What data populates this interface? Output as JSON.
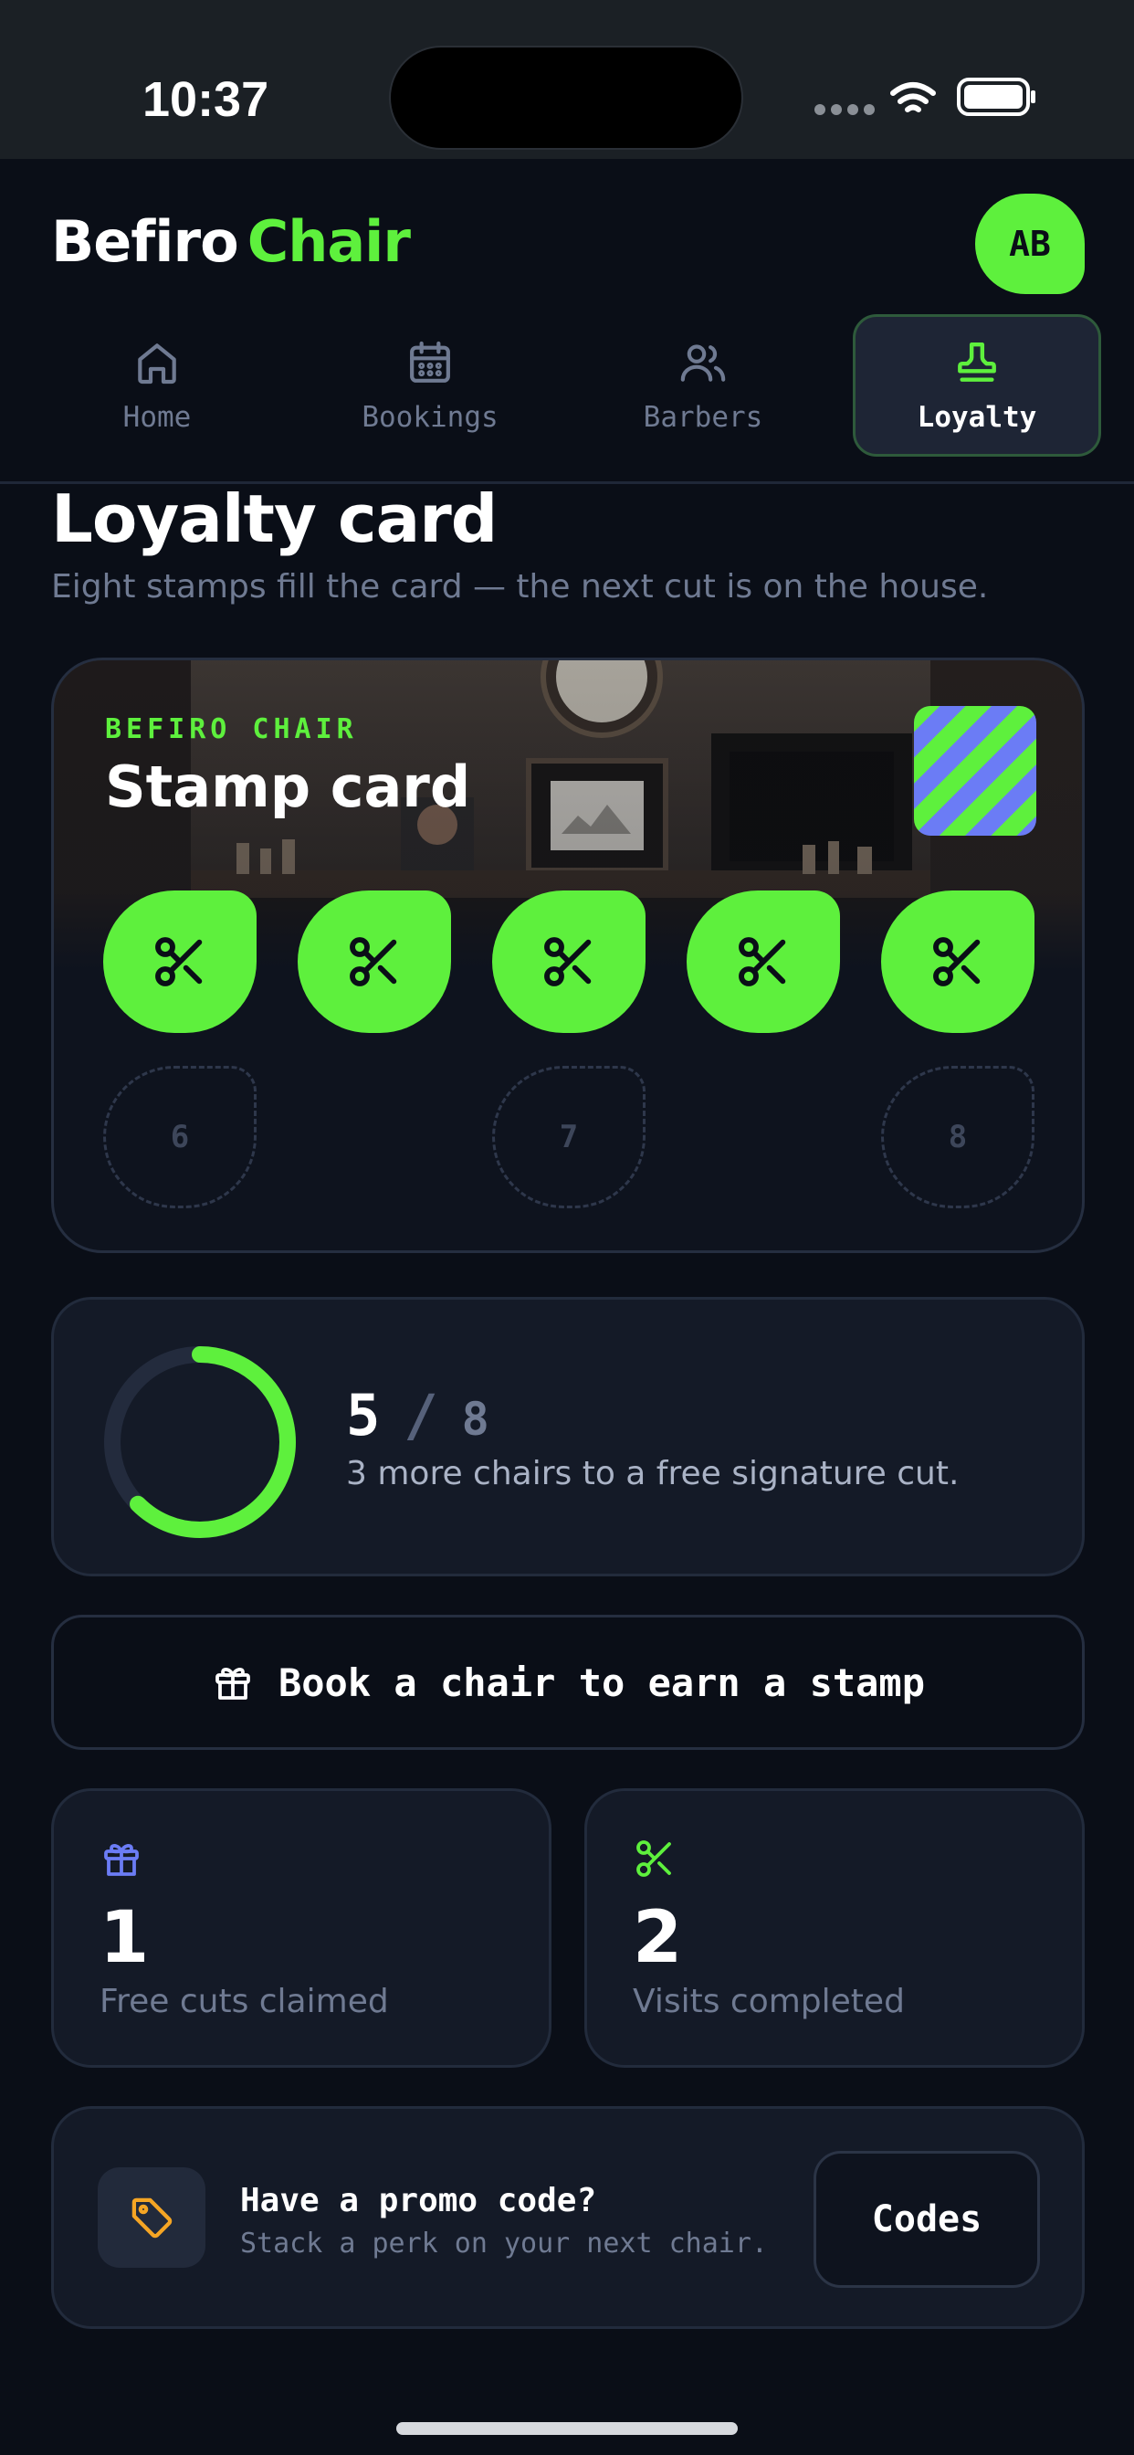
{
  "status_bar": {
    "time": "10:37"
  },
  "header": {
    "brand_part1": "Befiro",
    "brand_part2": "Chair",
    "avatar_initials": "AB"
  },
  "tabs": [
    {
      "label": "Home",
      "icon": "home-icon",
      "active": false
    },
    {
      "label": "Bookings",
      "icon": "calendar-icon",
      "active": false
    },
    {
      "label": "Barbers",
      "icon": "users-icon",
      "active": false
    },
    {
      "label": "Loyalty",
      "icon": "stamp-icon",
      "active": true
    }
  ],
  "page": {
    "title": "Loyalty card",
    "subtitle": "Eight stamps fill the card — the next cut is on the house."
  },
  "stamp_card": {
    "kicker": "BEFIRO CHAIR",
    "title": "Stamp card",
    "stamps_filled": 5,
    "stamps_total": 8,
    "empty_labels": [
      "6",
      "7",
      "8"
    ]
  },
  "progress": {
    "current": "5",
    "separator": "/",
    "total": "8",
    "fraction": 0.625,
    "message": "3 more chairs to a free signature cut."
  },
  "book_button": {
    "label": "Book a chair to earn a stamp",
    "icon": "gift-icon"
  },
  "stats": [
    {
      "value": "1",
      "label": "Free cuts claimed",
      "icon": "gift-icon",
      "color": "#6b7cf5"
    },
    {
      "value": "2",
      "label": "Visits completed",
      "icon": "scissors-icon",
      "color": "#5ef03d"
    }
  ],
  "promo": {
    "title": "Have a promo code?",
    "subtitle": "Stack a perk on your next chair.",
    "button_label": "Codes",
    "icon": "tag-icon",
    "icon_color": "#f5a524"
  },
  "colors": {
    "accent": "#5ef03d",
    "background": "#0a0e17",
    "card": "#141a27",
    "muted": "#6f7a92"
  }
}
